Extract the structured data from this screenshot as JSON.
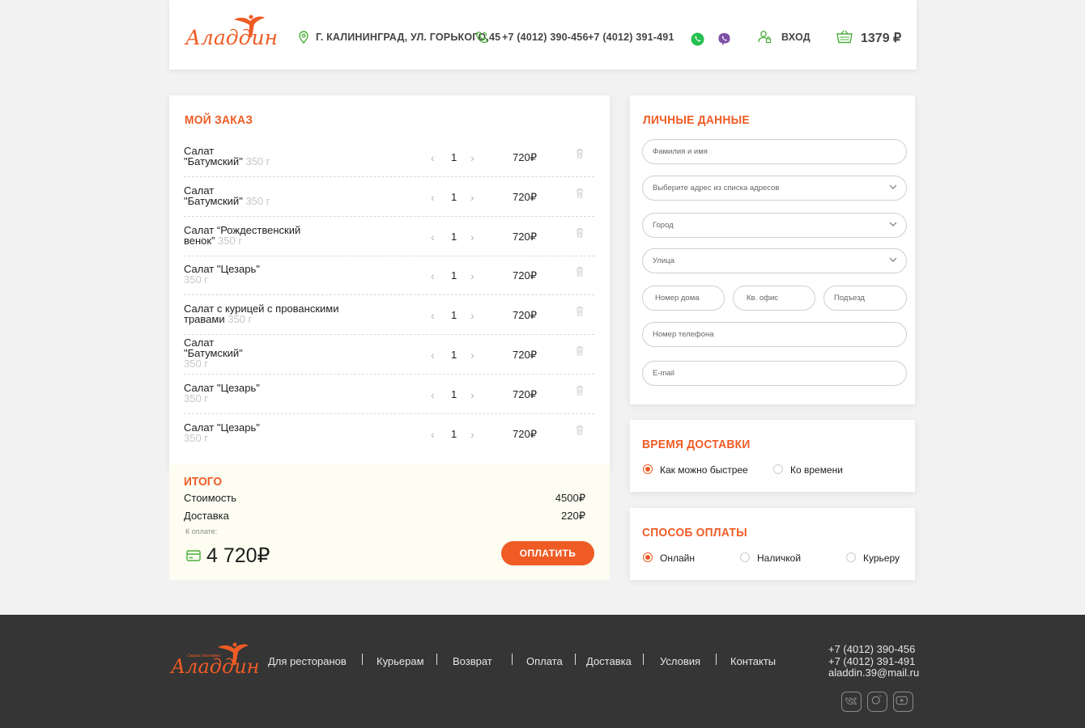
{
  "colors": {
    "accent": "#ef5b25",
    "green": "#4caf3c",
    "footer": "#353535"
  },
  "header": {
    "logo_text": "Аладдин",
    "address": "Г. КАЛИНИНГРАД, УЛ. ГОРЬКОГО,45",
    "phone1": "+7 (4012) 390-456",
    "phone2": "+7 (4012) 391-491",
    "login": "ВХОД",
    "cart_total": "1379 ₽"
  },
  "order": {
    "title": "МОЙ ЗАКАЗ",
    "items": [
      {
        "name": "Салат \"Батумский\"",
        "name_lines": [
          "Салат",
          "\"Батумский\""
        ],
        "weight": "350 г",
        "qty": "1",
        "price": "720₽"
      },
      {
        "name": "Салат  \"Батумский\"",
        "name_lines": [
          "Салат",
          " \"Батумский\""
        ],
        "weight": "350 г",
        "qty": "1",
        "price": "720₽"
      },
      {
        "name": "Салат “Рождественский венок”",
        "name_lines": [
          "Салат “Рождественский",
          "венок”"
        ],
        "weight": "350 г",
        "qty": "1",
        "price": "720₽"
      },
      {
        "name": "Салат \"Цезарь\"",
        "name_lines": [
          "Салат \"Цезарь\""
        ],
        "weight": "350 г",
        "qty": "1",
        "price": "720₽"
      },
      {
        "name": "Салат с курицей с прованскими травами",
        "name_lines": [
          "Салат с курицей с прованскими",
          "травами"
        ],
        "weight": "350 г",
        "qty": "1",
        "price": "720₽"
      },
      {
        "name": "Салат \"Батумский\"",
        "name_lines": [
          "Салат",
          "\"Батумский\""
        ],
        "weight": "350 г",
        "qty": "1",
        "price": "720₽"
      },
      {
        "name": "Салат \"Цезарь\"",
        "name_lines": [
          "Салат \"Цезарь\""
        ],
        "weight": "350 г",
        "qty": "1",
        "price": "720₽"
      },
      {
        "name": "Салат \"Цезарь\"",
        "name_lines": [
          "Салат \"Цезарь\""
        ],
        "weight": "350 г",
        "qty": "1",
        "price": "720₽"
      }
    ]
  },
  "total": {
    "title": "ИТОГО",
    "cost_label": "Стоимость",
    "cost_value": "4500₽",
    "delivery_label": "Доставка",
    "delivery_value": "220₽",
    "to_pay_label": "К оплате:",
    "to_pay_value": "4 720₽",
    "pay_button": "ОПЛАТИТЬ"
  },
  "personal": {
    "title": "ЛИЧНЫЕ ДАННЫЕ",
    "name_placeholder": "Фамилия и  имя",
    "address_placeholder": "Выберите адрес из списка адресов",
    "city_placeholder": "Город",
    "street_placeholder": "Улица",
    "house_placeholder": "Номер дома",
    "flat_placeholder": "Кв. офис",
    "entrance_placeholder": "Подъезд",
    "phone_placeholder": "Номер телефона",
    "email_placeholder": "E-mail"
  },
  "delivery_time": {
    "title": "ВРЕМЯ ДОСТАВКИ",
    "options": [
      {
        "label": "Как можно быстрее",
        "selected": true
      },
      {
        "label": "Ко времени",
        "selected": false
      }
    ]
  },
  "payment": {
    "title": "СПОСОБ ОПЛАТЫ",
    "options": [
      {
        "label": "Онлайн",
        "selected": true
      },
      {
        "label": "Наличкой",
        "selected": false
      },
      {
        "label": "Курьеру",
        "selected": false
      }
    ]
  },
  "footer": {
    "logo_caption": "Сервис доставки",
    "links": [
      "Для ресторанов",
      "Курьерам",
      "Возврат",
      "Оплата",
      "Доставка",
      "Условия",
      "Контакты"
    ],
    "phone1": "+7 (4012) 390-456",
    "phone2": "+7 (4012) 391-491",
    "email": "aladdin.39@mail.ru",
    "social": [
      "vk-icon",
      "instagram-icon",
      "youtube-icon"
    ]
  }
}
